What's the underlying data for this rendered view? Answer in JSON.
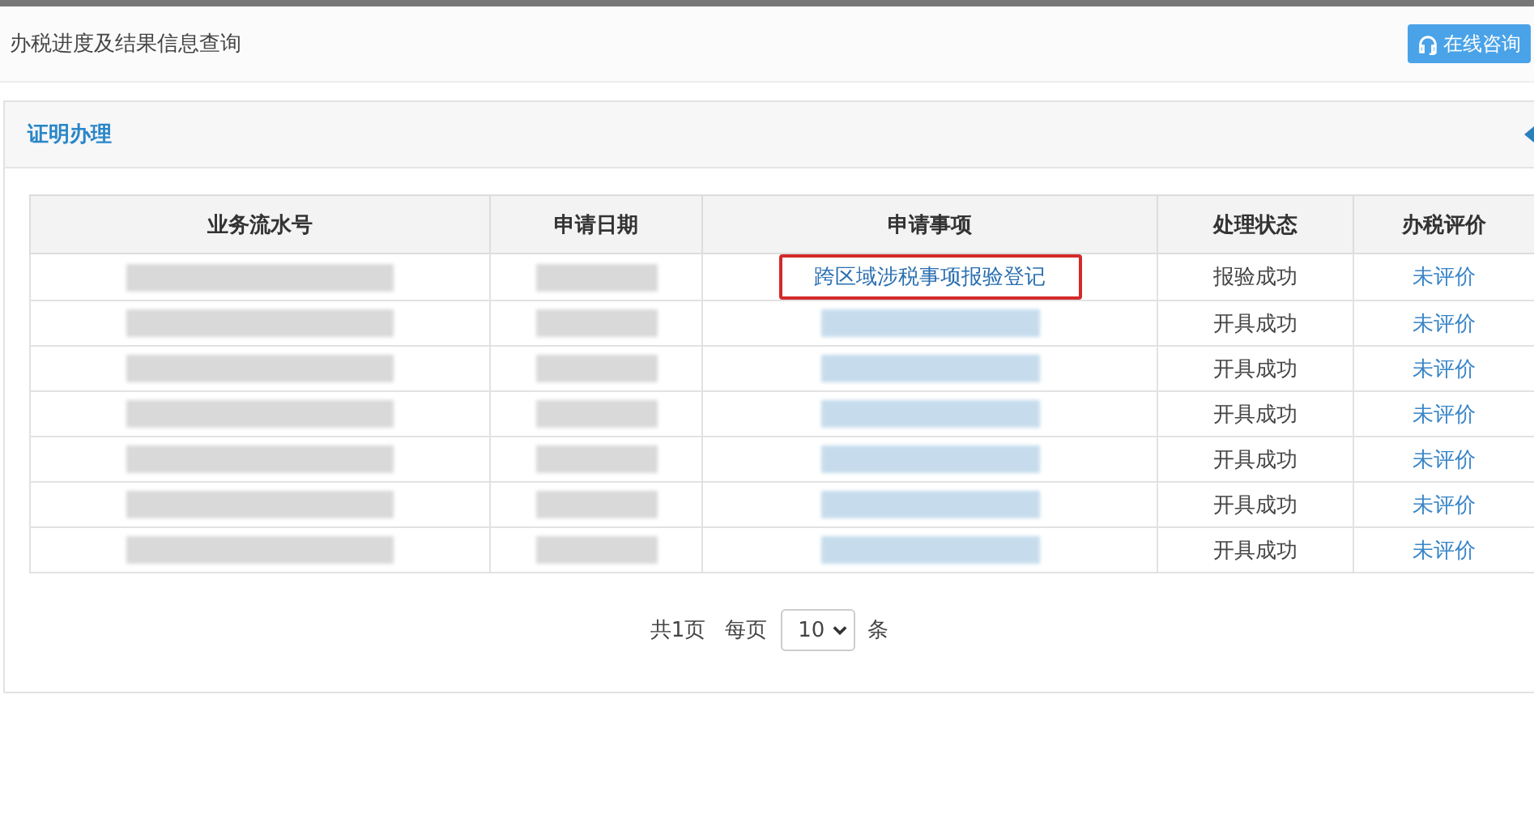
{
  "header": {
    "title": "办税进度及结果信息查询",
    "consult_button": "在线咨询"
  },
  "panel": {
    "title": "证明办理"
  },
  "table": {
    "columns": [
      "业务流水号",
      "申请日期",
      "申请事项",
      "处理状态",
      "办税评价"
    ],
    "rows": [
      {
        "item": "跨区域涉税事项报验登记",
        "highlighted": true,
        "status": "报验成功",
        "rating": "未评价"
      },
      {
        "highlighted": false,
        "status": "开具成功",
        "rating": "未评价"
      },
      {
        "highlighted": false,
        "status": "开具成功",
        "rating": "未评价"
      },
      {
        "highlighted": false,
        "status": "开具成功",
        "rating": "未评价"
      },
      {
        "highlighted": false,
        "status": "开具成功",
        "rating": "未评价"
      },
      {
        "highlighted": false,
        "status": "开具成功",
        "rating": "未评价"
      },
      {
        "highlighted": false,
        "status": "开具成功",
        "rating": "未评价"
      }
    ]
  },
  "pagination": {
    "total": "共1页",
    "per_page_label": "每页",
    "per_page": "10",
    "unit": "条"
  }
}
